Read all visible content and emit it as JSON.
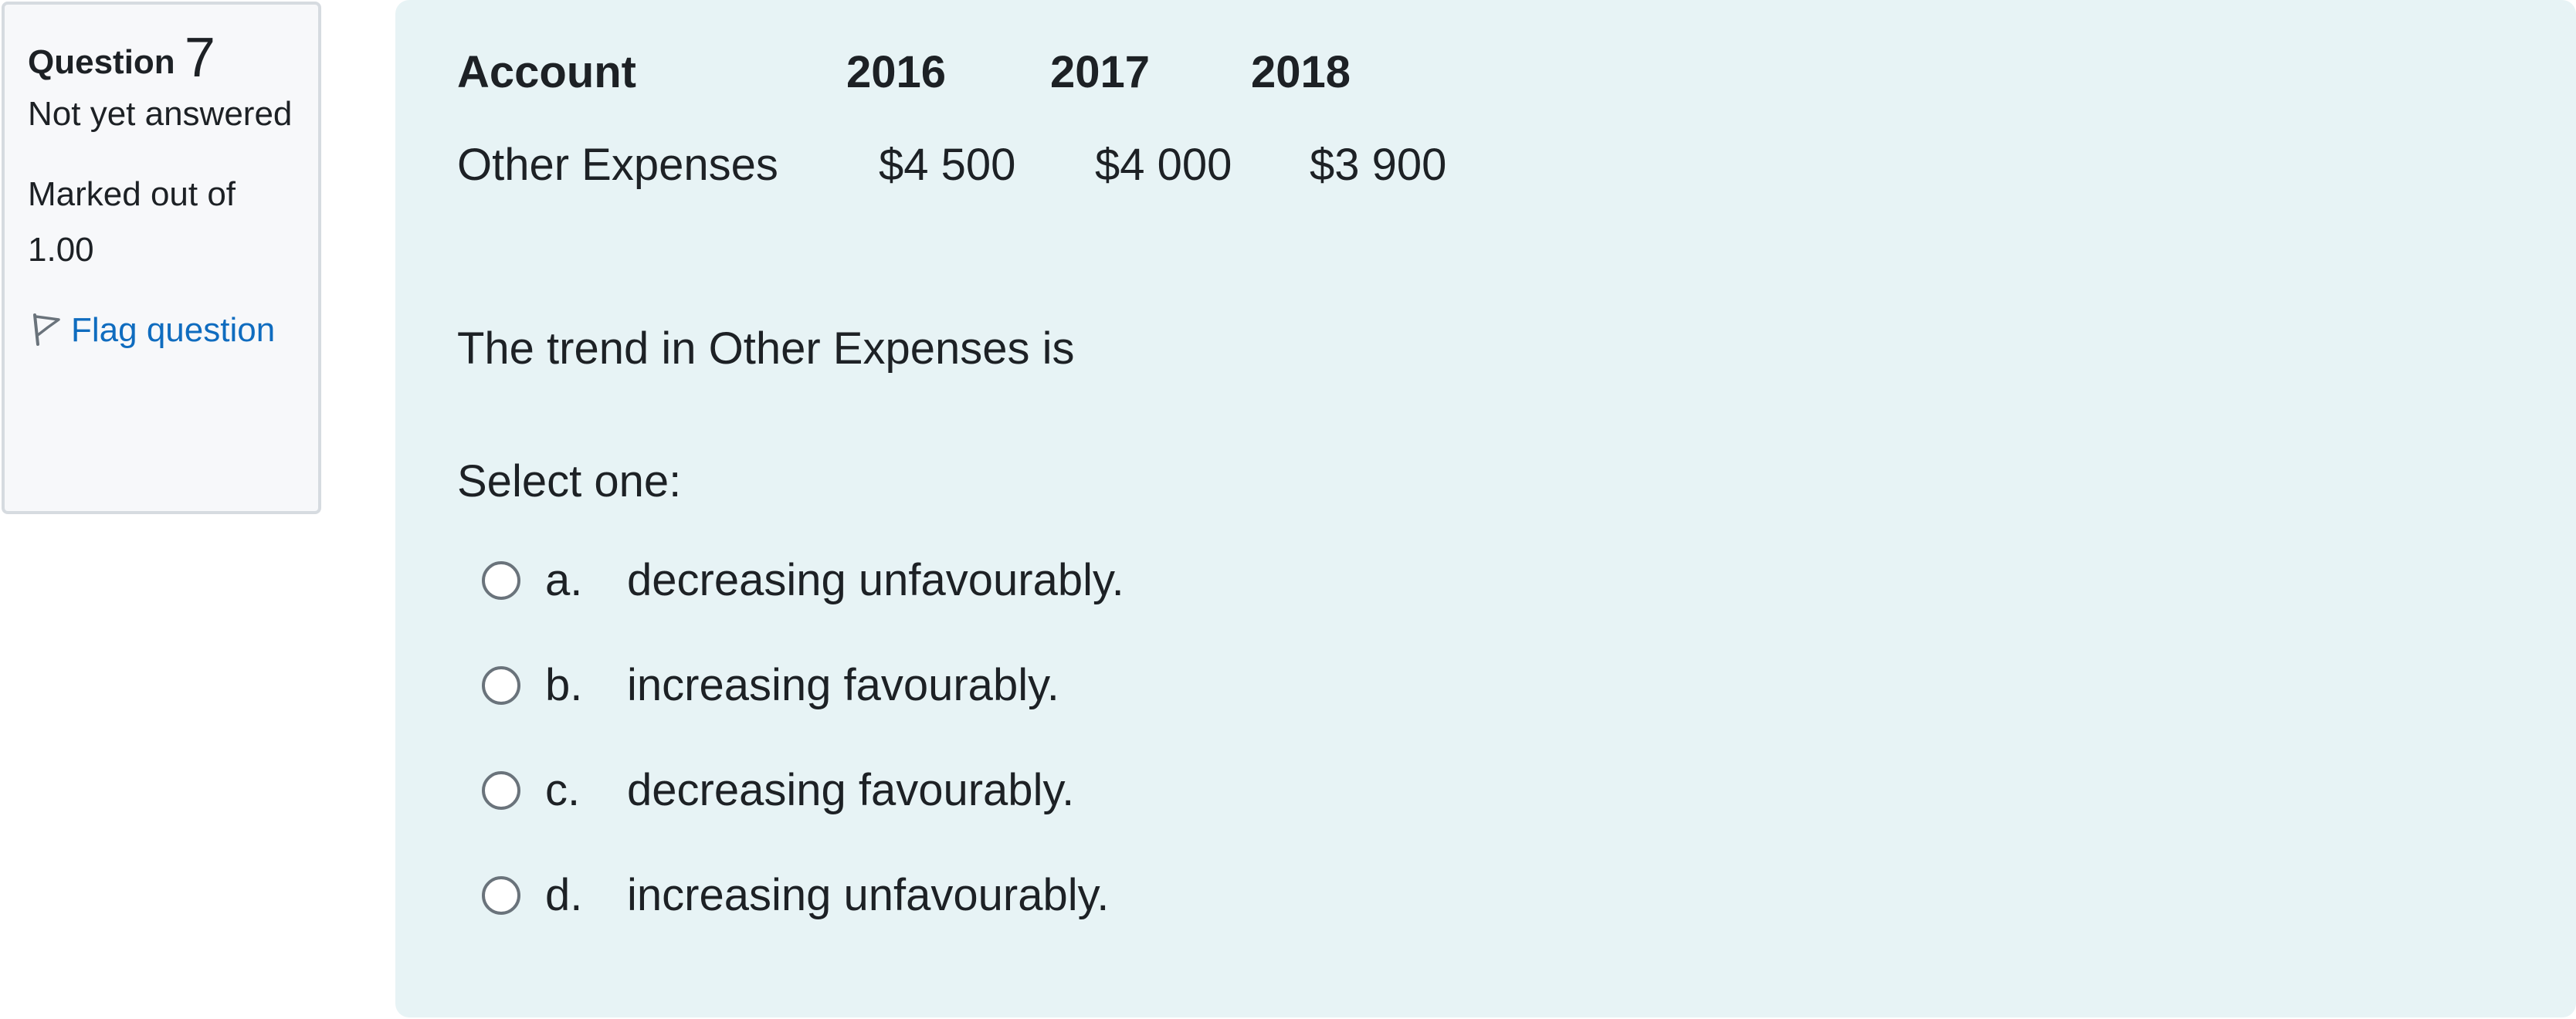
{
  "info": {
    "question_word": "Question",
    "question_number": "7",
    "state": "Not yet answered",
    "grade": "Marked out of 1.00",
    "flag_label": "Flag question"
  },
  "table": {
    "headers": [
      "Account",
      "2016",
      "2017",
      "2018"
    ],
    "rows": [
      [
        "Other Expenses",
        "$4 500",
        "$4 000",
        "$3 900"
      ]
    ]
  },
  "question_text": "The trend in Other Expenses is",
  "prompt": "Select one:",
  "answers": [
    {
      "letter": "a.",
      "text": "decreasing unfavourably."
    },
    {
      "letter": "b.",
      "text": "increasing favourably."
    },
    {
      "letter": "c.",
      "text": "decreasing favourably."
    },
    {
      "letter": "d.",
      "text": "increasing unfavourably."
    }
  ],
  "colors": {
    "content_background": "#e7f3f5",
    "info_background": "#f7f8fa",
    "link": "#0f6cbf",
    "text": "#1d2125"
  }
}
